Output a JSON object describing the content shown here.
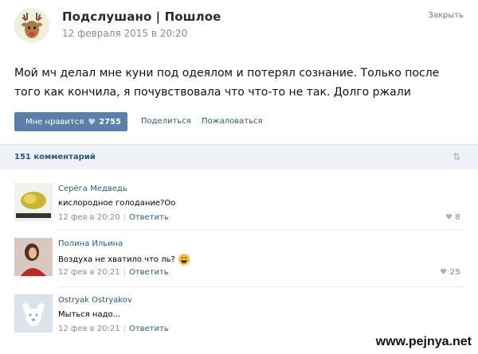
{
  "post": {
    "group_name": "Подслушано | Пошлое",
    "date": "12 февраля 2015 в 20:20",
    "close_label": "Закрыть",
    "text": "Мой мч делал мне куни под одеялом и потерял сознание. Только после того как кончила, я почувствовала что что-то не так. Долго ржали",
    "like_label": "Мне нравится",
    "like_count": "2755",
    "share_label": "Поделиться",
    "report_label": "Пожаловаться"
  },
  "comments_bar": {
    "count_label": "151 комментарий"
  },
  "comments": [
    {
      "author": "Серёга Медведь",
      "text": "кислородное голодание?Оо",
      "date": "12 фев в 20:20",
      "reply": "Ответить",
      "likes": "8",
      "has_emoji": false
    },
    {
      "author": "Полина Ильина",
      "text": "Воздуха не хватило что ль?",
      "date": "12 фев в 20:21",
      "reply": "Ответить",
      "likes": "25",
      "has_emoji": true
    },
    {
      "author": "Ostryak Ostryakov",
      "text": "Мыться надо...",
      "date": "12 фев в 20:21",
      "reply": "Ответить",
      "likes": "",
      "has_emoji": false
    }
  ],
  "watermark": "www.pejnya.net",
  "colors": {
    "accent": "#5b7fa6",
    "link": "#2b587a",
    "bar_bg": "#eef1f5"
  }
}
